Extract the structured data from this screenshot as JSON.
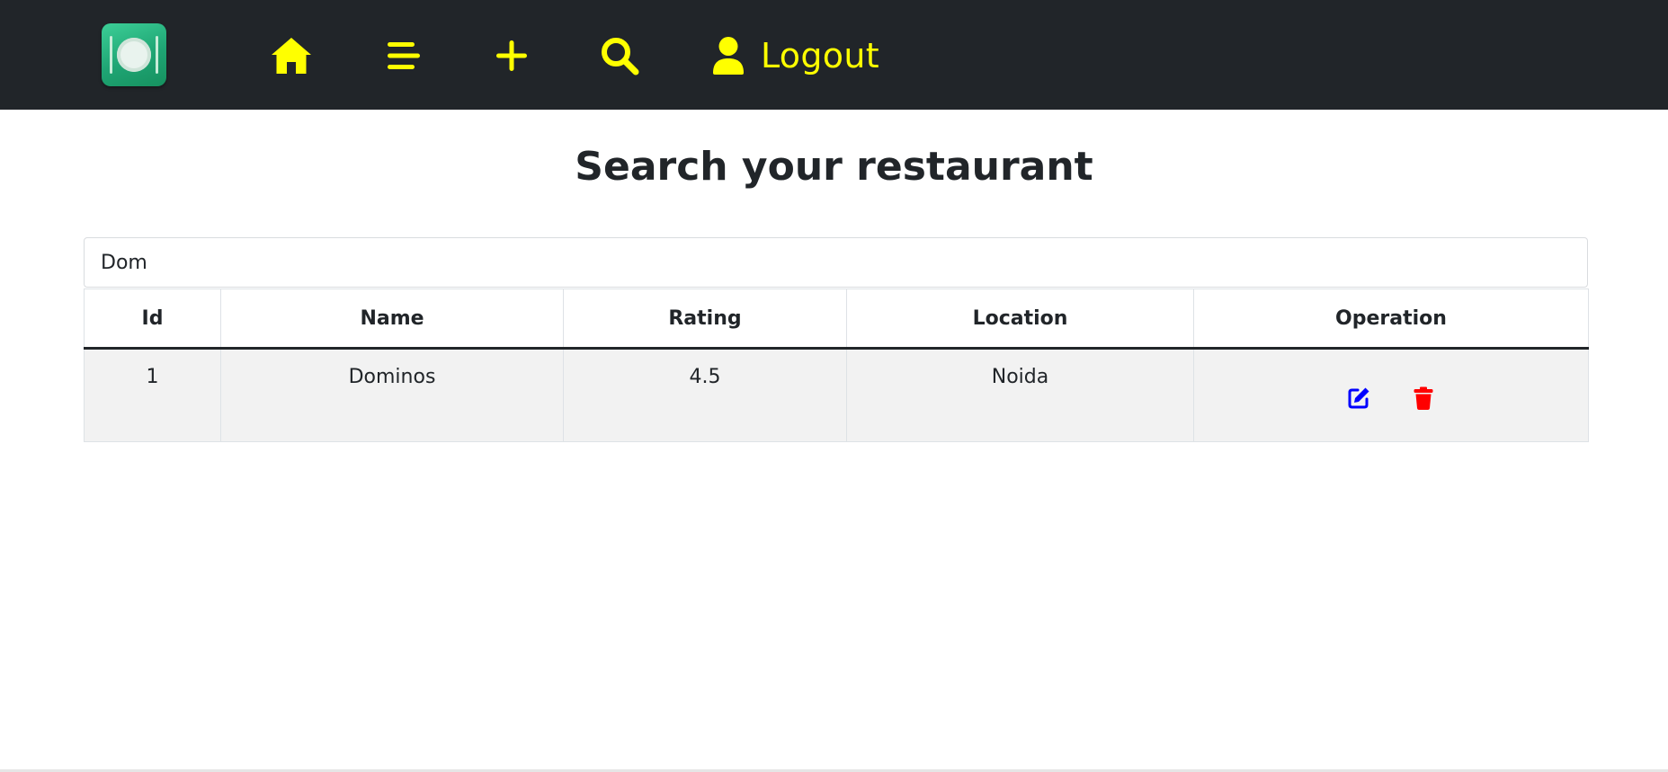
{
  "navbar": {
    "logo_icon": "restaurant-plate-icon",
    "accent_color": "#ffff00",
    "background_color": "#212529",
    "items": [
      {
        "icon": "home-icon"
      },
      {
        "icon": "list-icon"
      },
      {
        "icon": "plus-icon"
      },
      {
        "icon": "search-icon"
      }
    ],
    "logout": {
      "icon": "user-icon",
      "label": "Logout"
    }
  },
  "main": {
    "title": "Search your restaurant",
    "search": {
      "value": "Dom",
      "placeholder": ""
    },
    "table": {
      "headers": [
        "Id",
        "Name",
        "Rating",
        "Location",
        "Operation"
      ],
      "rows": [
        {
          "id": "1",
          "name": "Dominos",
          "rating": "4.5",
          "location": "Noida",
          "operations": [
            "edit-icon",
            "delete-icon"
          ]
        }
      ]
    },
    "colors": {
      "edit": "#0000ff",
      "delete": "#ff0000"
    }
  }
}
